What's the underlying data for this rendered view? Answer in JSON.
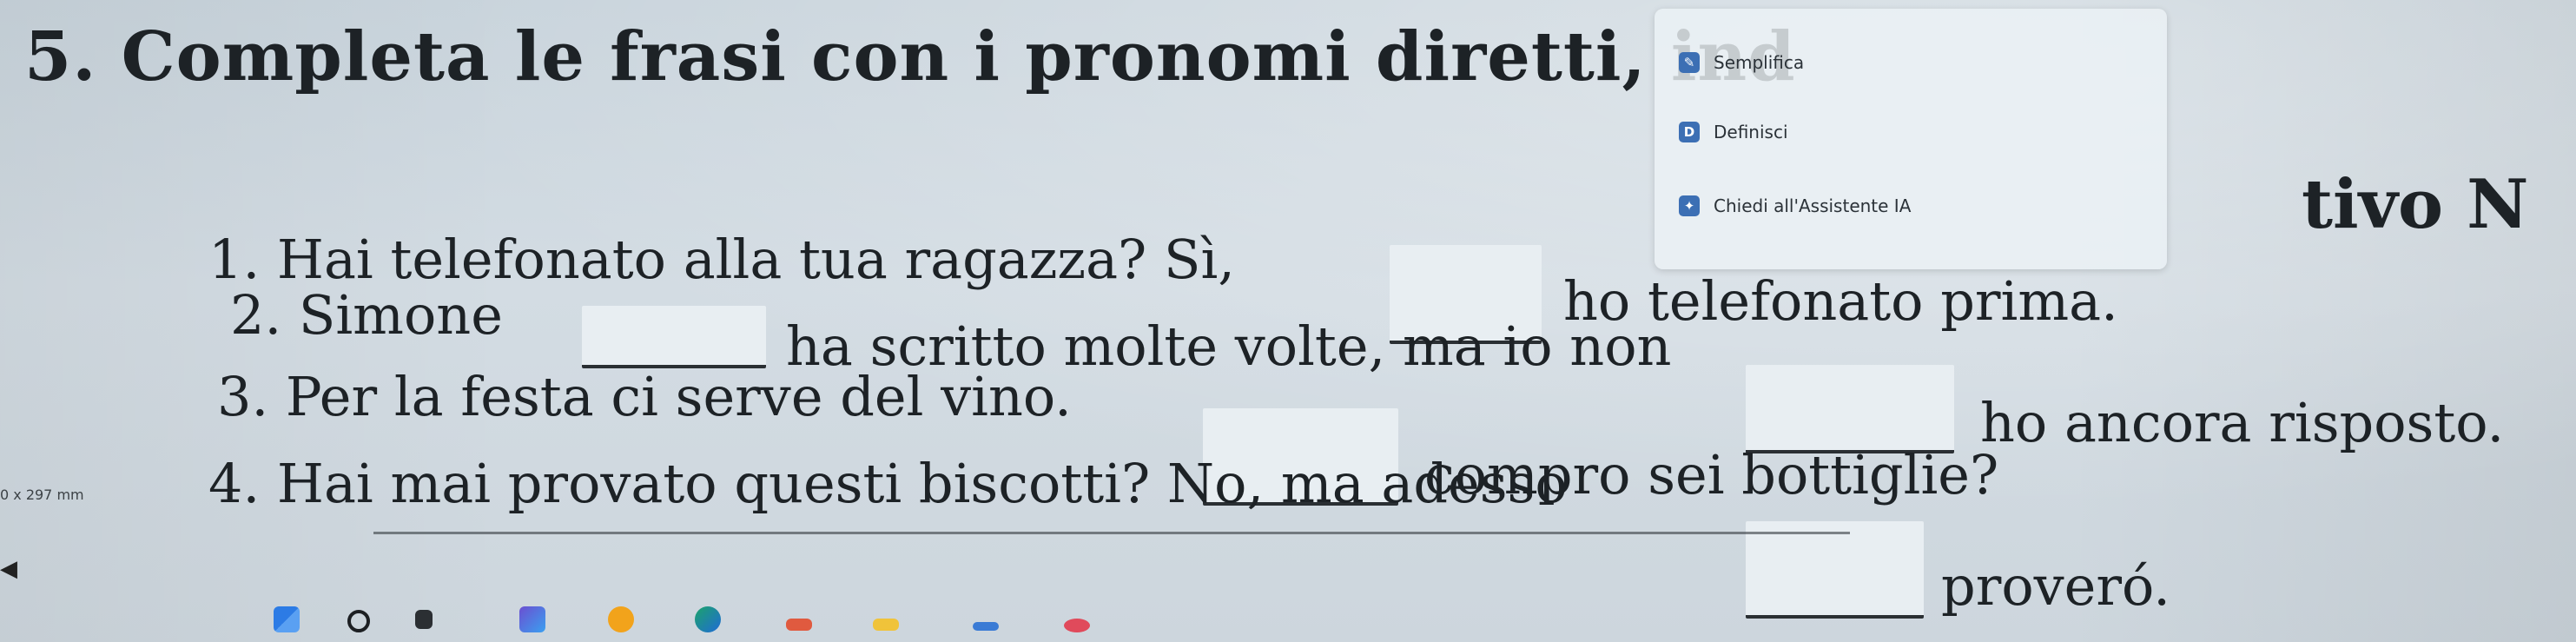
{
  "exercise": {
    "title": "5. Completa le frasi con i pronomi diretti, ind",
    "title_tail": "tivo N"
  },
  "context_menu": {
    "items": [
      {
        "label": "Semplifica",
        "icon": "simplify-icon"
      },
      {
        "label": "Definisci",
        "icon": "define-icon"
      },
      {
        "label": "Chiedi all'Assistente IA",
        "icon": "ai-assistant-icon"
      }
    ]
  },
  "sentences": [
    {
      "num": "1.",
      "before": "Hai telefonato alla tua ragazza? Sì,",
      "after": "ho telefonato prima."
    },
    {
      "num": "2.",
      "before": "Simone",
      "after": "ha scritto molte volte, ma io non"
    },
    {
      "continuation": "ho ancora risposto."
    },
    {
      "num": "3.",
      "before": "Per la festa ci serve del vino.",
      "after": "compro sei bottiglie?"
    },
    {
      "num": "4.",
      "before": "Hai mai provato questi biscotti? No, ma adesso",
      "after": "proveró."
    }
  ],
  "page_dimensions_label": "0 x 297 mm",
  "colors": {
    "background": "#cdd6dd",
    "blank_fill": "#e8eef2",
    "accent_blue": "#3c6fb4"
  }
}
